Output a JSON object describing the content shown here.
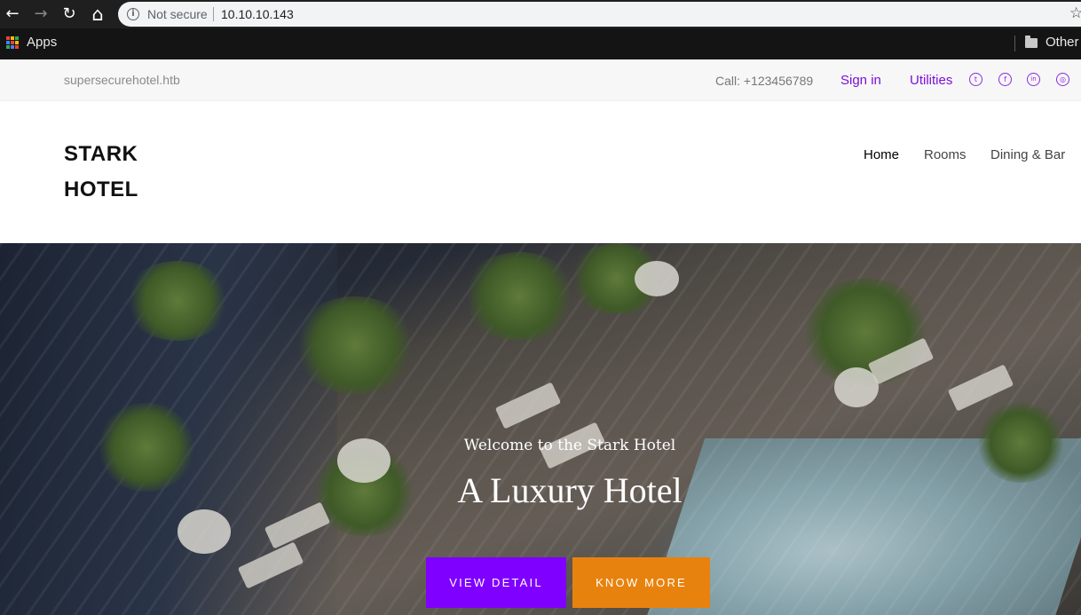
{
  "browser": {
    "back_glyph": "←",
    "forward_glyph": "→",
    "reload_glyph": "↻",
    "home_glyph": "⌂",
    "security_label": "Not secure",
    "url": "10.10.10.143",
    "star_glyph": "☆",
    "bookmarks": {
      "apps_label": "Apps",
      "other_label": "Other"
    }
  },
  "topbar": {
    "domain": "supersecurehotel.htb",
    "phone": "Call: +123456789",
    "sign_in": "Sign in",
    "utilities": "Utilities",
    "social": [
      {
        "name": "twitter-icon",
        "glyph": "t"
      },
      {
        "name": "facebook-icon",
        "glyph": "f"
      },
      {
        "name": "linkedin-icon",
        "glyph": "in"
      },
      {
        "name": "dribbble-icon",
        "glyph": "◎"
      }
    ]
  },
  "header": {
    "logo_line1": "STARK",
    "logo_line2": "HOTEL",
    "nav": [
      "Home",
      "Rooms",
      "Dining & Bar"
    ],
    "active_nav": "Home"
  },
  "hero": {
    "subtitle": "Welcome to the Stark Hotel",
    "title": "A Luxury Hotel",
    "buttons": {
      "view_detail": "VIEW DETAIL",
      "know_more": "KNOW MORE"
    }
  },
  "colors": {
    "accent_purple": "#7f00ff",
    "accent_orange": "#e8820e",
    "link_purple": "#7b0fd8"
  }
}
